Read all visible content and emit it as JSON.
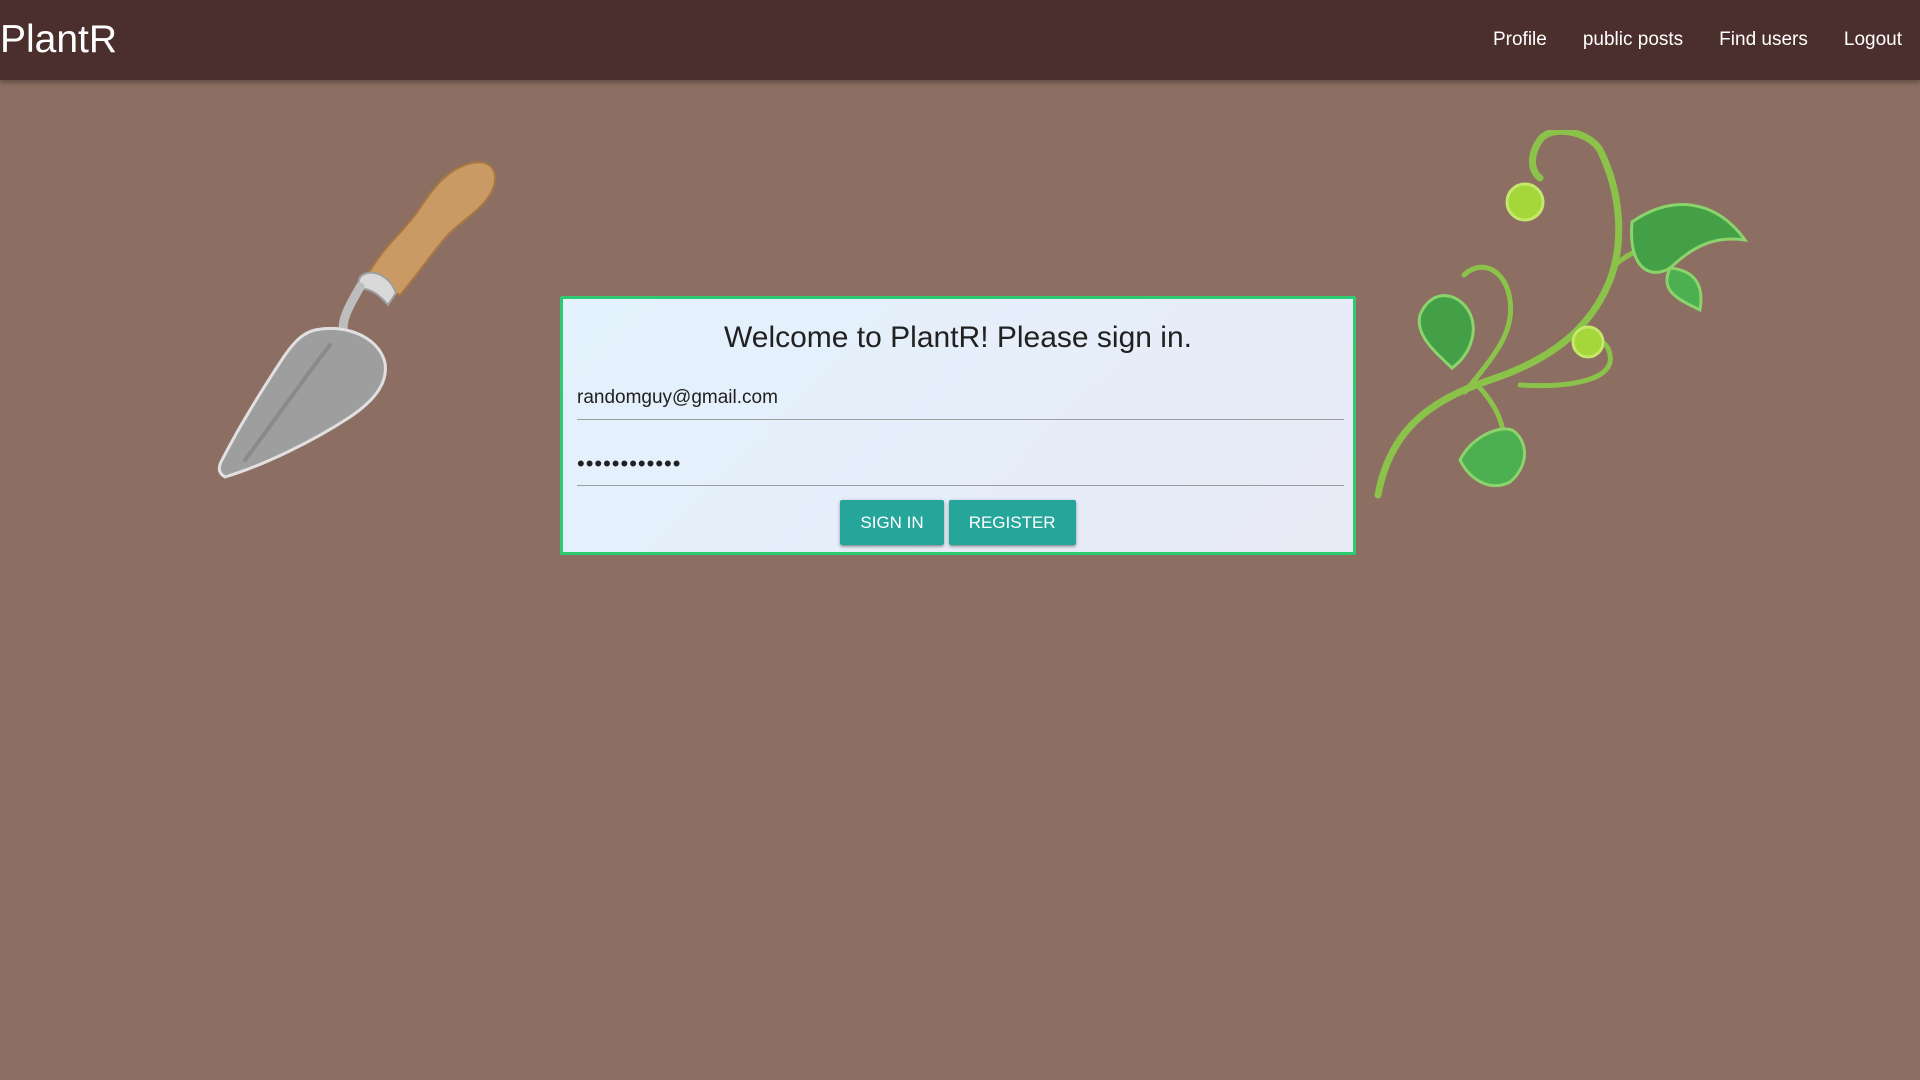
{
  "app": {
    "brand": "PlantR"
  },
  "nav": {
    "items": [
      {
        "label": "Profile"
      },
      {
        "label": "public posts"
      },
      {
        "label": "Find users"
      },
      {
        "label": "Logout"
      }
    ]
  },
  "login": {
    "title": "Welcome to PlantR! Please sign in.",
    "email_value": "randomguy@gmail.com",
    "password_value": "randomguypw1",
    "sign_in_label": "Sign in",
    "register_label": "Register"
  },
  "decorations": {
    "left": "trowel-illustration",
    "right": "vine-illustration"
  },
  "colors": {
    "navbar": "#4b2f2c",
    "background": "#8c6e63",
    "card_border": "#2ecc71",
    "button": "#26a69a"
  }
}
